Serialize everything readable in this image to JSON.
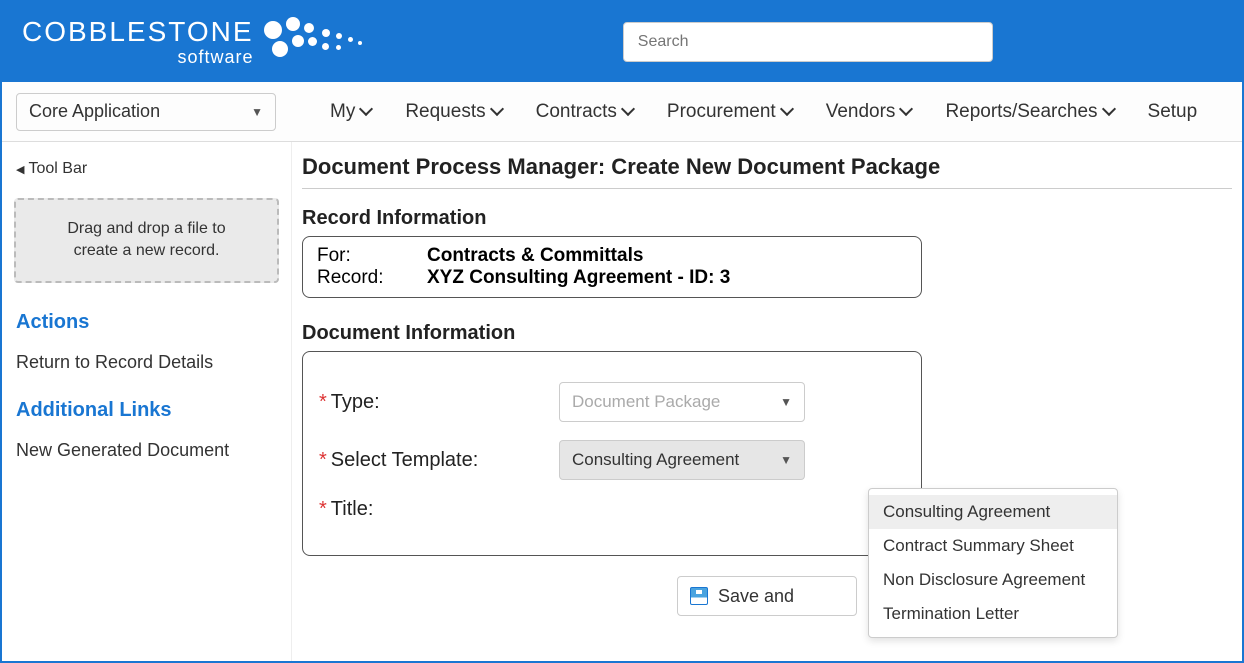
{
  "brand": {
    "name": "COBBLESTONE",
    "sub": "software"
  },
  "search": {
    "placeholder": "Search"
  },
  "app_select": {
    "label": "Core Application"
  },
  "menu": {
    "items": [
      "My",
      "Requests",
      "Contracts",
      "Procurement",
      "Vendors",
      "Reports/Searches",
      "Setup"
    ]
  },
  "sidebar": {
    "toolbar_link": "Tool Bar",
    "dropzone_line1": "Drag and drop a file to",
    "dropzone_line2": "create a new record.",
    "actions_heading": "Actions",
    "actions_link": "Return to Record Details",
    "links_heading": "Additional Links",
    "links_link": "New Generated Document"
  },
  "main": {
    "page_title": "Document Process Manager: Create New Document Package",
    "record_info_heading": "Record Information",
    "for_label": "For:",
    "for_value": "Contracts & Committals",
    "record_label": "Record:",
    "record_value": "XYZ Consulting Agreement - ID: 3",
    "doc_info_heading": "Document Information",
    "type_label": "Type:",
    "type_value": "Document Package",
    "template_label": "Select Template:",
    "template_value": "Consulting Agreement",
    "title_label": "Title:",
    "save_label": "Save and",
    "template_options": [
      "Consulting Agreement",
      "Contract Summary Sheet",
      "Non Disclosure Agreement",
      "Termination Letter"
    ]
  }
}
